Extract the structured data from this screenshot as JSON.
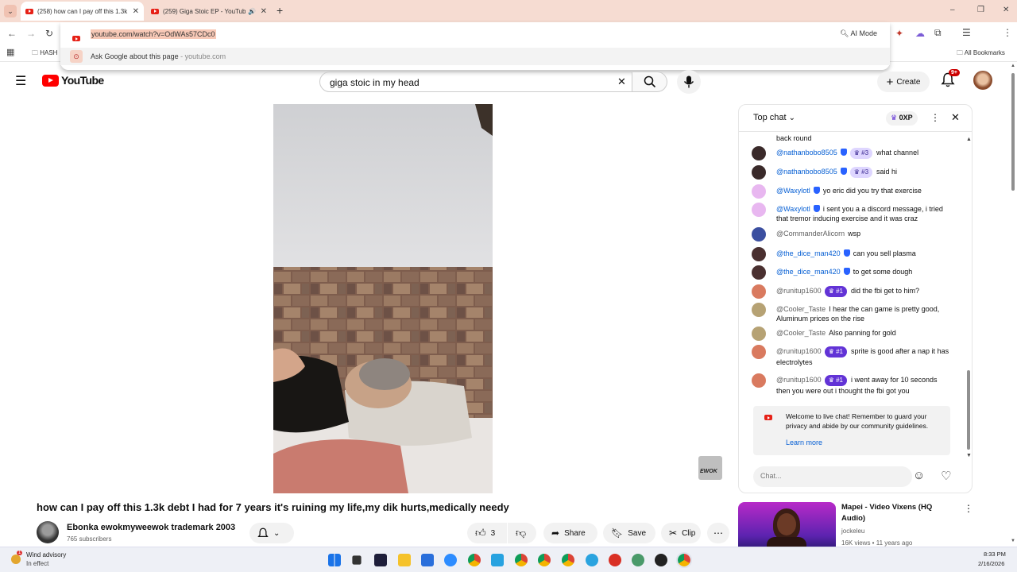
{
  "tabs": [
    {
      "title": "(258) how can I pay off this 1.3k",
      "close": "✕"
    },
    {
      "title": "(259) Giga Stoic EP - YouTube",
      "close": "✕"
    }
  ],
  "new_tab": "+",
  "omnibox": {
    "url": "youtube.com/watch?v=OdWAs57CDc0",
    "ai_mode": "AI Mode",
    "ask_google": "Ask Google about this page",
    "ask_google_site": "youtube.com"
  },
  "bookmarks": {
    "first": "HASH",
    "all": "All Bookmarks"
  },
  "youtube": {
    "logo": "YouTube",
    "search_query": "giga stoic in my head",
    "create": "Create",
    "notif_badge": "9+"
  },
  "video": {
    "title": "how can I pay off this 1.3k debt I had for 7 years it's ruining my life,my dik hurts,medically needy",
    "channel": "Ebonka ewokmyweewok trademark 2003",
    "subscribers": "765 subscribers",
    "likes": "3",
    "share": "Share",
    "save": "Save",
    "clip": "Clip",
    "watermark": "EWOK"
  },
  "chat": {
    "mode": "Top chat",
    "xp": "0XP",
    "messages": [
      {
        "author": "",
        "text": "back round",
        "color": "#888888"
      },
      {
        "author": "@nathanbobo8505",
        "verified": true,
        "rank": "#3",
        "text": "what channel",
        "color": "#3a2a2a"
      },
      {
        "author": "@nathanbobo8505",
        "verified": true,
        "rank": "#3",
        "text": "said hi",
        "color": "#3a2a2a"
      },
      {
        "author": "@Waxylotl",
        "verified": true,
        "text": "yo eric did you try that exercise",
        "color": "#e8b7f0"
      },
      {
        "author": "@Waxylotl",
        "verified": true,
        "text": "i sent you a a discord message, i tried that tremor inducing exercise and it was craz",
        "color": "#e8b7f0"
      },
      {
        "author": "@CommanderAlicorn",
        "plain": true,
        "text": "wsp",
        "color": "#3b4fa0"
      },
      {
        "author": "@the_dice_man420",
        "verified": true,
        "text": "can you sell plasma",
        "color": "#4a3030"
      },
      {
        "author": "@the_dice_man420",
        "verified": true,
        "text": "to get some dough",
        "color": "#4a3030"
      },
      {
        "author": "@runitup1600",
        "plain": true,
        "rank": "#1",
        "top": true,
        "text": "did the fbi get to him?",
        "color": "#d97a5f"
      },
      {
        "author": "@Cooler_Taste",
        "plain": true,
        "text": "I hear the can game is pretty good, Aluminum prices on the rise",
        "color": "#b6a274"
      },
      {
        "author": "@Cooler_Taste",
        "plain": true,
        "text": "Also panning for gold",
        "color": "#b6a274"
      },
      {
        "author": "@runitup1600",
        "plain": true,
        "rank": "#1",
        "top": true,
        "text": "sprite is good after a nap it has electrolytes",
        "color": "#d97a5f"
      },
      {
        "author": "@runitup1600",
        "plain": true,
        "rank": "#1",
        "top": true,
        "text": "i went away for 10 seconds then you were out i thought the fbi got you",
        "color": "#d97a5f"
      }
    ],
    "welcome": "Welcome to live chat! Remember to guard your privacy and abide by our community guidelines.",
    "learn_more": "Learn more",
    "input_placeholder": "Chat..."
  },
  "recommended": {
    "title": "Mapei - Video Vixens (HQ Audio)",
    "channel": "jockeleu",
    "meta": "16K views • 11 years ago"
  },
  "taskbar": {
    "weather_title": "Wind advisory",
    "weather_sub": "In effect",
    "weather_badge": "1",
    "time": "8:33 PM",
    "date": "2/16/2026"
  },
  "colors": {
    "yt_red": "#ff0000",
    "link_blue": "#065fd4",
    "tab_bar": "#f6dcd2",
    "rank_purple": "#6233d6"
  }
}
